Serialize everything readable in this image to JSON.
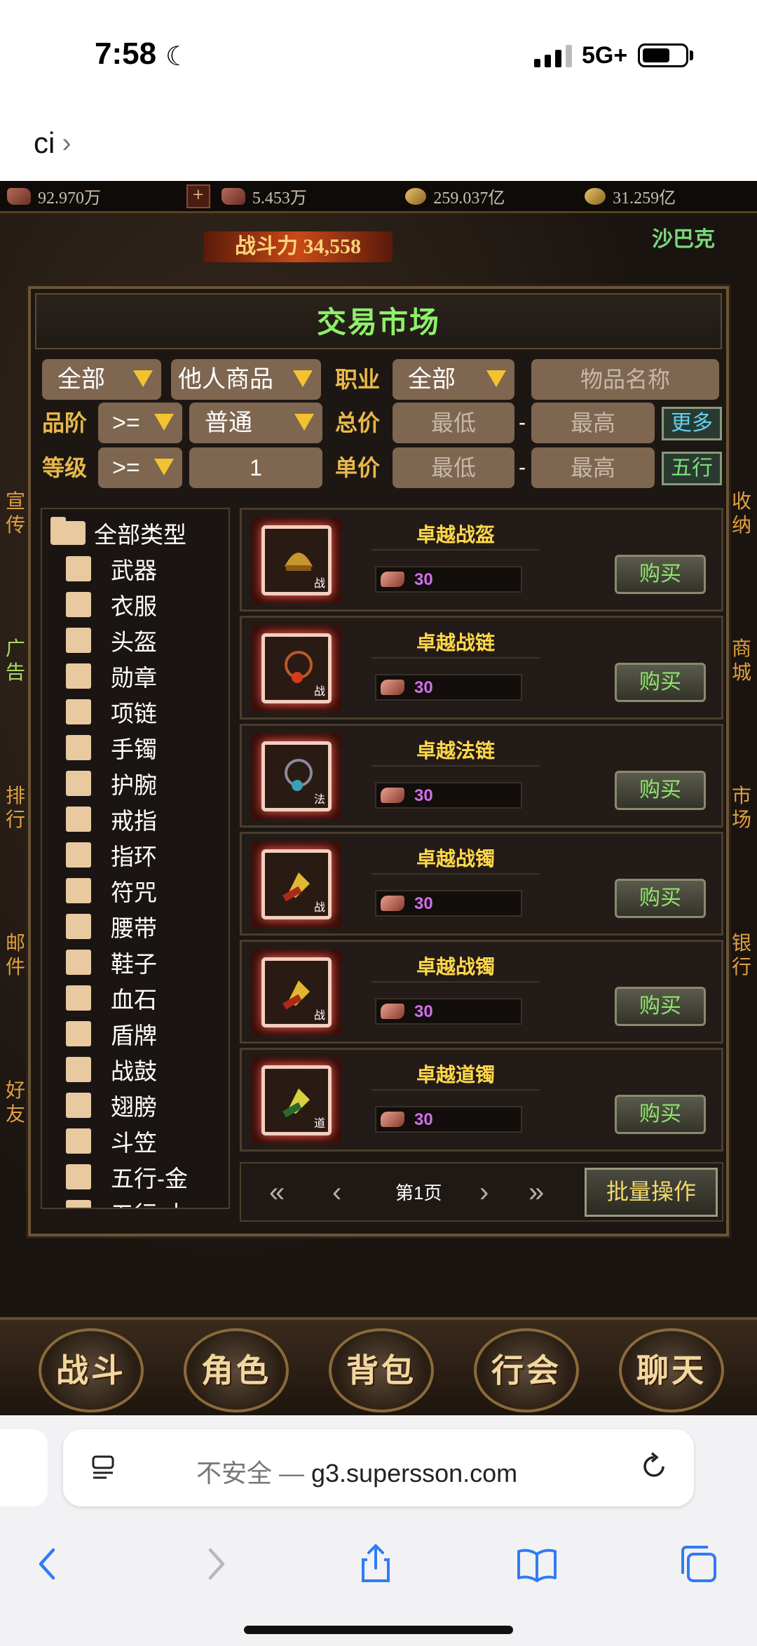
{
  "status": {
    "time": "7:58",
    "network": "5G+"
  },
  "back_label": "ci",
  "resources": [
    "92.970万",
    "5.453万",
    "259.037亿",
    "31.259亿"
  ],
  "power": "战斗力 34,558",
  "server_name": "沙巴克",
  "side_labels_left": [
    "宣传",
    "广告",
    "排行",
    "邮件",
    "好友"
  ],
  "side_labels_right": [
    "收纳",
    "商城",
    "市场",
    "银行"
  ],
  "panel": {
    "title": "交易市场",
    "filters": {
      "category": "全部",
      "source": "他人商品",
      "class_label": "职业",
      "class_value": "全部",
      "name_placeholder": "物品名称",
      "quality_label": "品阶",
      "quality_op": ">=",
      "quality_value": "普通",
      "total_label": "总价",
      "level_label": "等级",
      "level_op": ">=",
      "level_value": "1",
      "unit_label": "单价",
      "min_placeholder": "最低",
      "max_placeholder": "最高",
      "dash": "-",
      "more_btn": "更多",
      "element_btn": "五行"
    },
    "tree": {
      "root": "全部类型",
      "items": [
        "武器",
        "衣服",
        "头盔",
        "勋章",
        "项链",
        "手镯",
        "护腕",
        "戒指",
        "指环",
        "符咒",
        "腰带",
        "鞋子",
        "血石",
        "盾牌",
        "战鼓",
        "翅膀",
        "斗笠",
        "五行-金",
        "五行-木"
      ]
    },
    "items": [
      {
        "name": "卓越战盔",
        "price": "30",
        "tag": "战",
        "buy": "购买"
      },
      {
        "name": "卓越战链",
        "price": "30",
        "tag": "战",
        "buy": "购买"
      },
      {
        "name": "卓越法链",
        "price": "30",
        "tag": "法",
        "buy": "购买"
      },
      {
        "name": "卓越战镯",
        "price": "30",
        "tag": "战",
        "buy": "购买"
      },
      {
        "name": "卓越战镯",
        "price": "30",
        "tag": "战",
        "buy": "购买"
      },
      {
        "name": "卓越道镯",
        "price": "30",
        "tag": "道",
        "buy": "购买"
      }
    ],
    "pager": {
      "page_text": "第1页",
      "batch": "批量操作"
    }
  },
  "menu": [
    "战斗",
    "角色",
    "背包",
    "行会",
    "聊天"
  ],
  "safari": {
    "insecure": "不安全 — ",
    "domain": "g3.supersson.com"
  }
}
